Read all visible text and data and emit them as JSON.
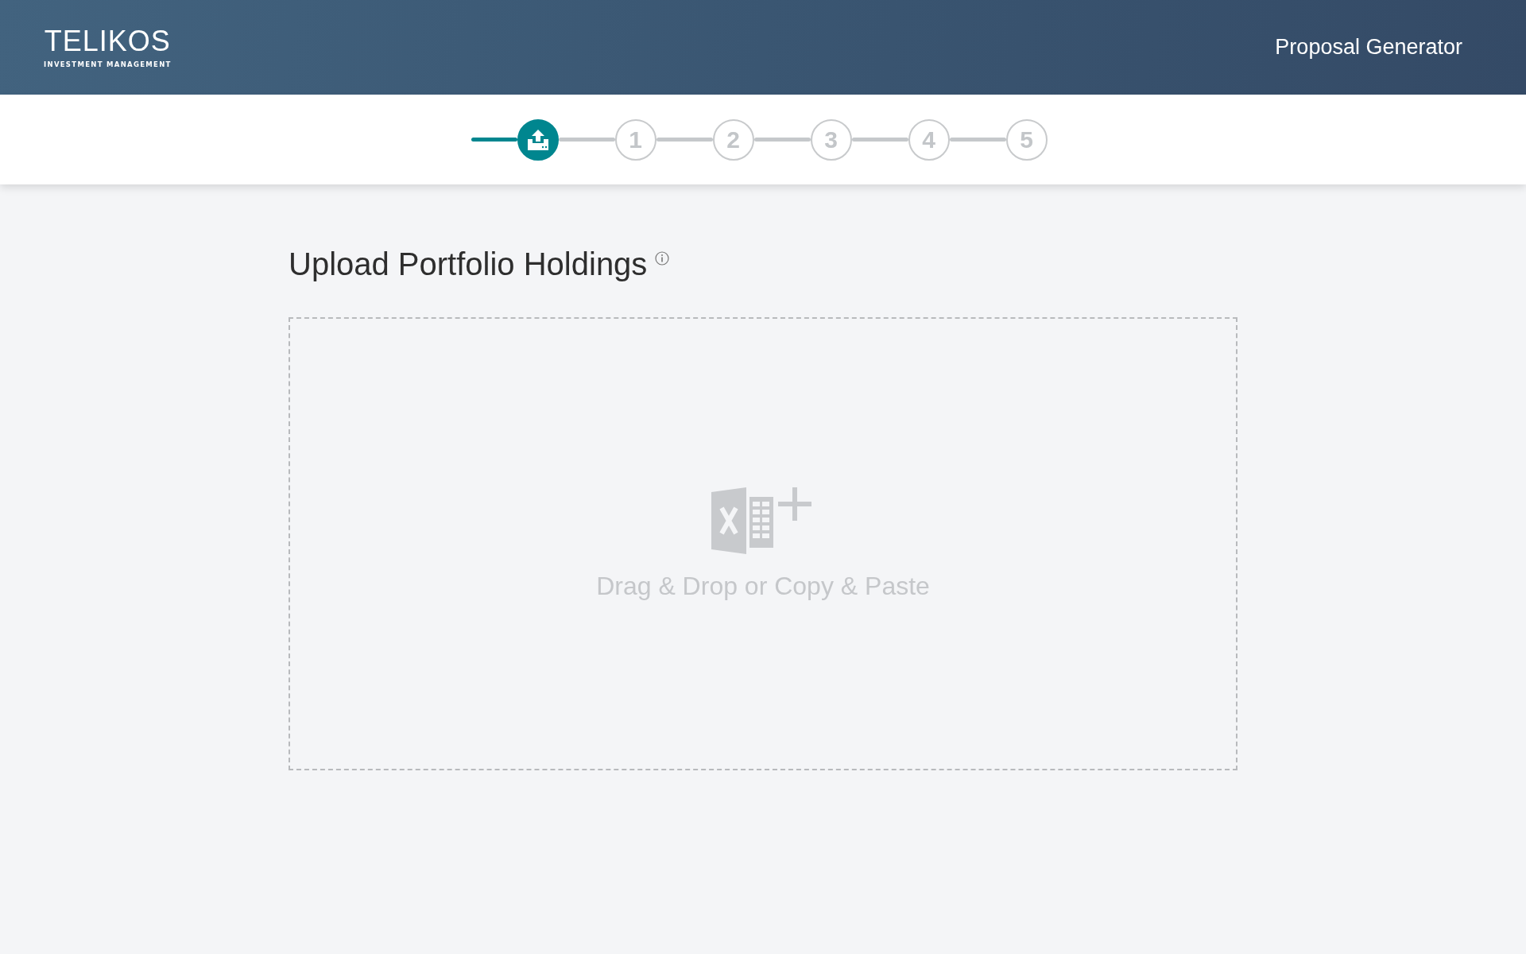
{
  "header": {
    "logo": {
      "name": "TELIKOS",
      "tagline": "INVESTMENT MANAGEMENT"
    },
    "title": "Proposal Generator"
  },
  "steps": [
    {
      "kind": "upload",
      "selected": true
    },
    {
      "kind": "number",
      "label": "1",
      "selected": false
    },
    {
      "kind": "number",
      "label": "2",
      "selected": false
    },
    {
      "kind": "number",
      "label": "3",
      "selected": false
    },
    {
      "kind": "number",
      "label": "4",
      "selected": false
    },
    {
      "kind": "number",
      "label": "5",
      "selected": false
    }
  ],
  "page": {
    "title": "Upload Portfolio Holdings"
  },
  "dropzone": {
    "text": "Drag & Drop or Copy & Paste"
  }
}
